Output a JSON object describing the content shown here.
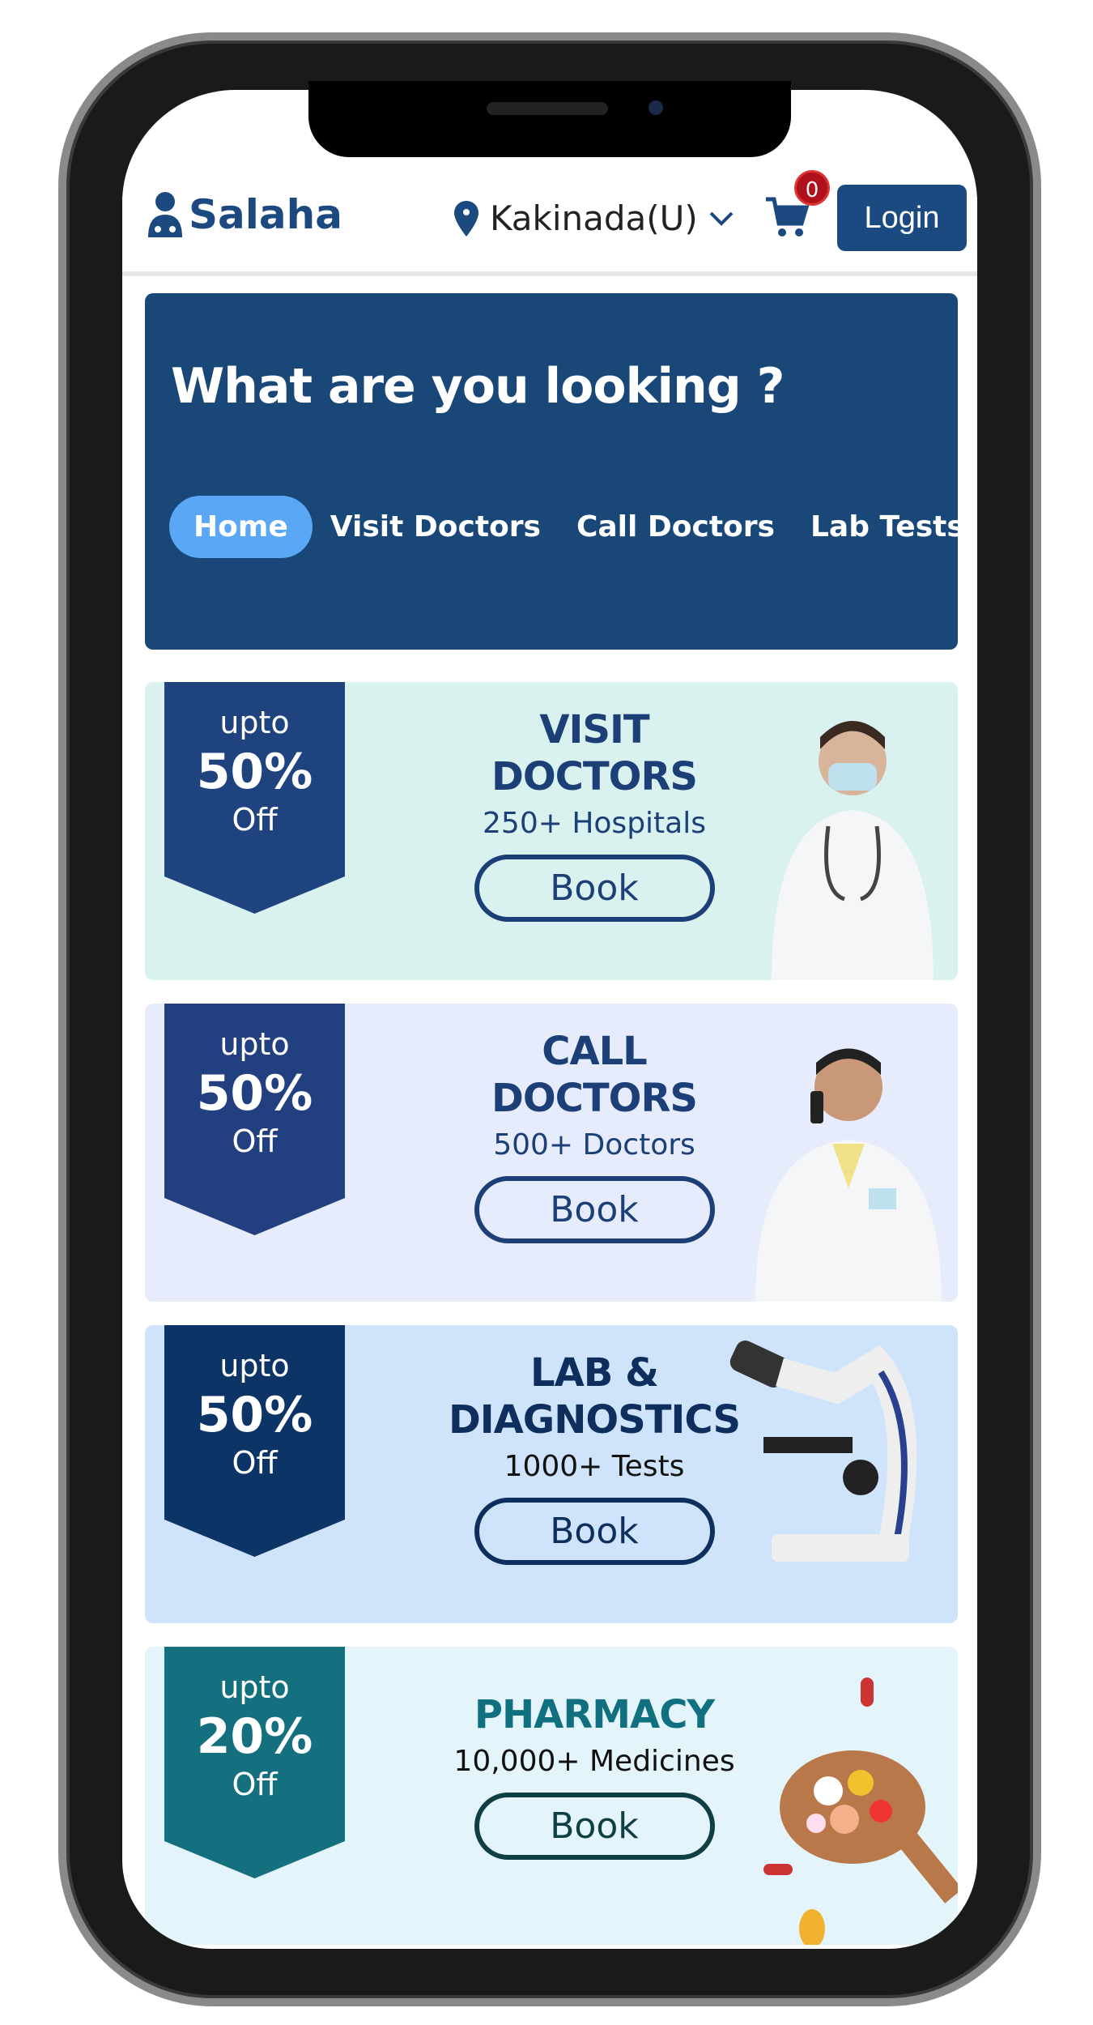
{
  "header": {
    "brand": "Salaha",
    "location": "Kakinada(U)",
    "cart_count": "0",
    "login_label": "Login"
  },
  "hero": {
    "title": "What are you looking ?",
    "tabs": [
      {
        "label": "Home",
        "active": true
      },
      {
        "label": "Visit Doctors"
      },
      {
        "label": "Call Doctors"
      },
      {
        "label": "Lab Tests"
      }
    ]
  },
  "cards": [
    {
      "upto": "upto",
      "discount": "50%",
      "off": "Off",
      "title1": "VISIT",
      "title2": "DOCTORS",
      "subtitle": "250+ Hospitals",
      "button": "Book",
      "bg": "#d9f1ef",
      "ribbon": "#1f437f",
      "text": "#1c3f78"
    },
    {
      "upto": "upto",
      "discount": "50%",
      "off": "Off",
      "title1": "CALL",
      "title2": "DOCTORS",
      "subtitle": "500+ Doctors",
      "button": "Book",
      "bg": "#e6ecfb",
      "ribbon": "#223f7f",
      "text": "#1c3f78"
    },
    {
      "upto": "upto",
      "discount": "50%",
      "off": "Off",
      "title1": "LAB &",
      "title2": "DIAGNOSTICS",
      "subtitle": "1000+ Tests",
      "button": "Book",
      "bg": "#cfe4fb",
      "ribbon": "#0d3466",
      "text": "#0e2f5e"
    },
    {
      "upto": "upto",
      "discount": "20%",
      "off": "Off",
      "title1": "PHARMACY",
      "title2": "",
      "subtitle": "10,000+ Medicines",
      "button": "Book",
      "bg": "#e3f4fb",
      "ribbon": "#14707f",
      "text": "#11707f"
    }
  ]
}
